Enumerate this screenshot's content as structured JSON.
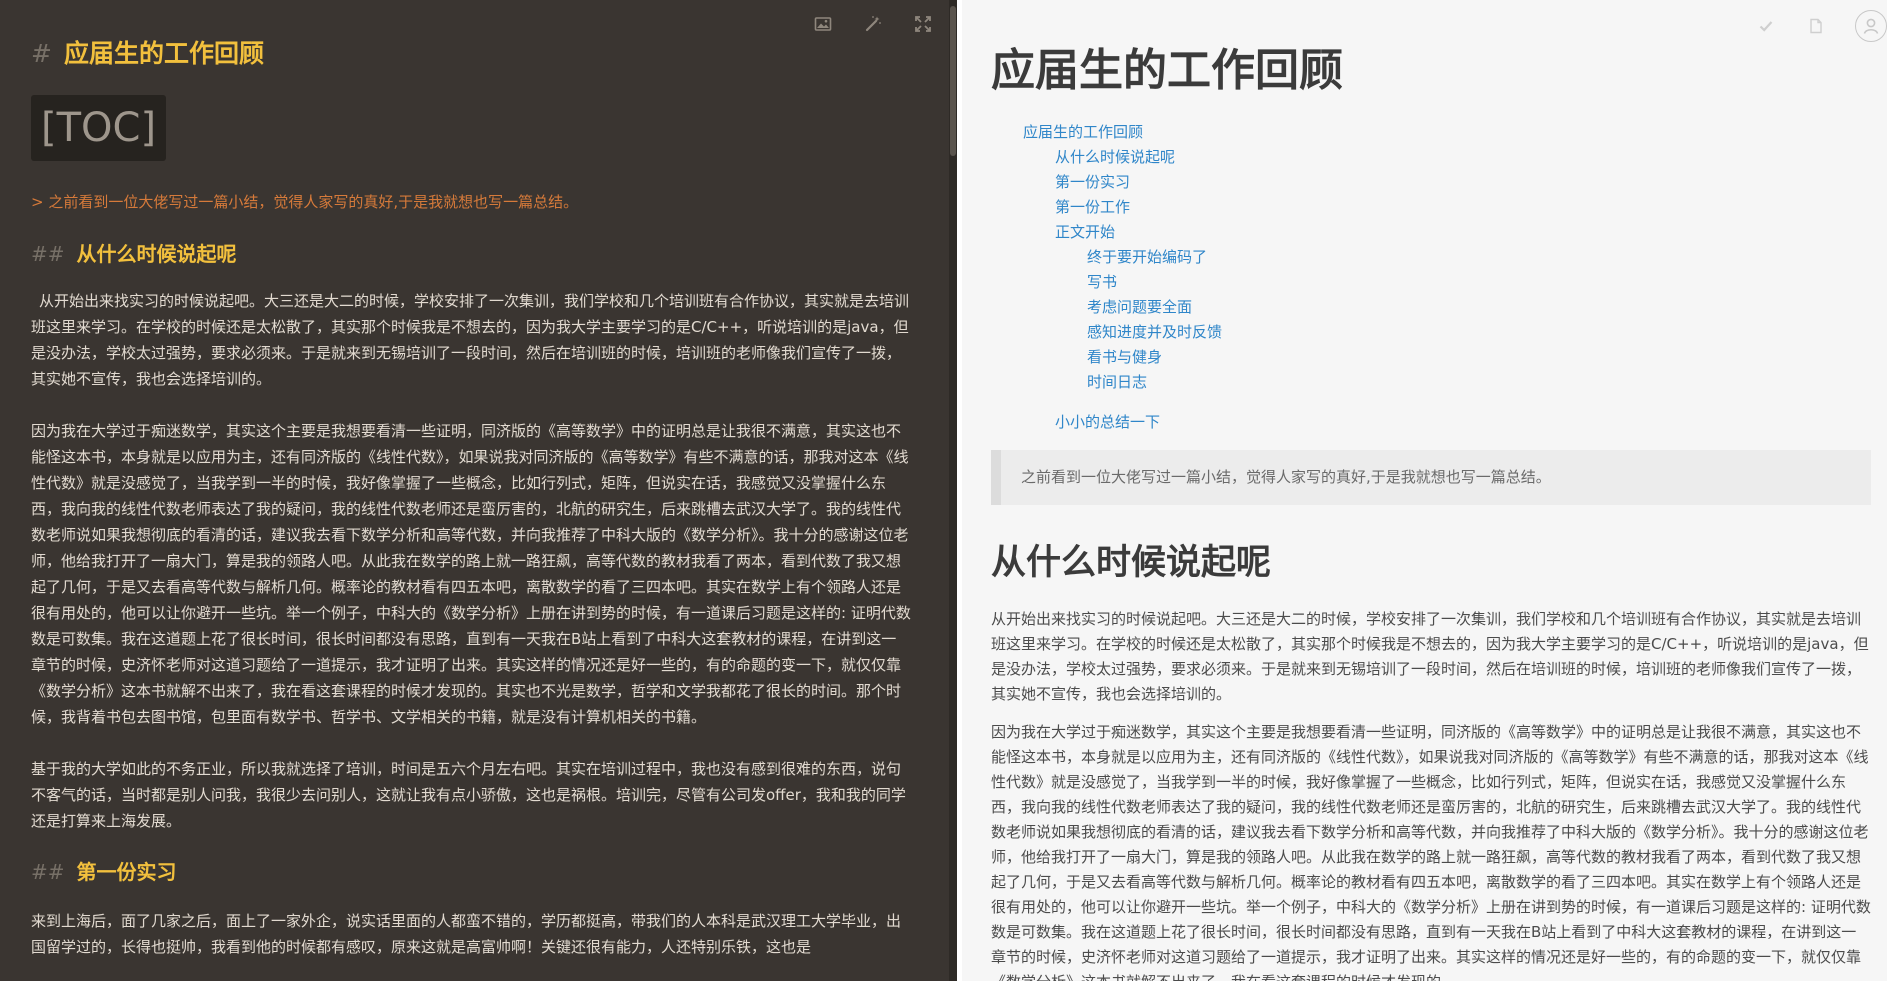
{
  "editor": {
    "toolbar": {
      "image_icon": "image-icon",
      "magic_icon": "magic-wand-icon",
      "expand_icon": "fullscreen-icon"
    },
    "h1_hash": "#",
    "h1": "应届生的工作回顾",
    "toc": "[TOC]",
    "quote": "> 之前看到一位大佬写过一篇小结，觉得人家写的真好,于是我就想也写一篇总结。",
    "h2_hash": "##",
    "h2_first": "从什么时候说起呢",
    "paragraphs": [
      "从开始出来找实习的时候说起吧。大三还是大二的时候，学校安排了一次集训，我们学校和几个培训班有合作协议，其实就是去培训班这里来学习。在学校的时候还是太松散了，其实那个时候我是不想去的，因为我大学主要学习的是C/C++，听说培训的是java，但是没办法，学校太过强势，要求必须来。于是就来到无锡培训了一段时间，然后在培训班的时候，培训班的老师像我们宣传了一拨，其实她不宣传，我也会选择培训的。",
      "因为我在大学过于痴迷数学，其实这个主要是我想要看清一些证明，同济版的《高等数学》中的证明总是让我很不满意，其实这也不能怪这本书，本身就是以应用为主，还有同济版的《线性代数》，如果说我对同济版的《高等数学》有些不满意的话，那我对这本《线性代数》就是没感觉了，当我学到一半的时候，我好像掌握了一些概念，比如行列式，矩阵，但说实在话，我感觉又没掌握什么东西，我向我的线性代数老师表达了我的疑问，我的线性代数老师还是蛮厉害的，北航的研究生，后来跳槽去武汉大学了。我的线性代数老师说如果我想彻底的看清的话，建议我去看下数学分析和高等代数，并向我推荐了中科大版的《数学分析》。我十分的感谢这位老师，他给我打开了一扇大门，算是我的领路人吧。从此我在数学的路上就一路狂飙，高等代数的教材我看了两本，看到代数了我又想起了几何，于是又去看高等代数与解析几何。概率论的教材看有四五本吧，离散数学的看了三四本吧。其实在数学上有个领路人还是很有用处的，他可以让你避开一些坑。举一个例子，中科大的《数学分析》上册在讲到势的时候，有一道课后习题是这样的: 证明代数数是可数集。我在这道题上花了很长时间，很长时间都没有思路，直到有一天我在B站上看到了中科大这套教材的课程，在讲到这一章节的时候，史济怀老师对这道习题给了一道提示，我才证明了出来。其实这样的情况还是好一些的，有的命题的变一下，就仅仅靠《数学分析》这本书就解不出来了，我在看这套课程的时候才发现的。其实也不光是数学，哲学和文学我都花了很长的时间。那个时候，我背着书包去图书馆，包里面有数学书、哲学书、文学相关的书籍，就是没有计算机相关的书籍。",
      "基于我的大学如此的不务正业，所以我就选择了培训，时间是五六个月左右吧。其实在培训过程中，我也没有感到很难的东西，说句不客气的话，当时都是别人问我，我很少去问别人，这就让我有点小骄傲，这也是祸根。培训完，尽管有公司发offer，我和我的同学还是打算来上海发展。"
    ],
    "h2_second": "第一份实习",
    "last_paragraph": "来到上海后，面了几家之后，面上了一家外企，说实话里面的人都蛮不错的，学历都挺高，带我们的人本科是武汉理工大学毕业，出国留学过的，长得也挺帅，我看到他的时候都有感叹，原来这就是高富帅啊！关键还很有能力，人还特别乐铁，这也是"
  },
  "preview": {
    "toolbar": {
      "check_icon": "check-icon",
      "doc_icon": "document-icon",
      "avatar_icon": "user-avatar-icon"
    },
    "h1": "应届生的工作回顾",
    "toc": [
      {
        "level": 1,
        "label": "应届生的工作回顾"
      },
      {
        "level": 2,
        "label": "从什么时候说起呢"
      },
      {
        "level": 2,
        "label": "第一份实习"
      },
      {
        "level": 2,
        "label": "第一份工作"
      },
      {
        "level": 2,
        "label": "正文开始"
      },
      {
        "level": 3,
        "label": "终于要开始编码了"
      },
      {
        "level": 3,
        "label": "写书"
      },
      {
        "level": 3,
        "label": "考虑问题要全面"
      },
      {
        "level": 3,
        "label": "感知进度并及时反馈"
      },
      {
        "level": 3,
        "label": "看书与健身"
      },
      {
        "level": 3,
        "label": "时间日志"
      },
      {
        "level": 2,
        "label": "小小的总结一下"
      }
    ],
    "quote": "之前看到一位大佬写过一篇小结，觉得人家写的真好,于是我就想也写一篇总结。",
    "h2": "从什么时候说起呢",
    "paragraphs": [
      "从开始出来找实习的时候说起吧。大三还是大二的时候，学校安排了一次集训，我们学校和几个培训班有合作协议，其实就是去培训班这里来学习。在学校的时候还是太松散了，其实那个时候我是不想去的，因为我大学主要学习的是C/C++，听说培训的是java，但是没办法，学校太过强势，要求必须来。于是就来到无锡培训了一段时间，然后在培训班的时候，培训班的老师像我们宣传了一拨，其实她不宣传，我也会选择培训的。",
      "因为我在大学过于痴迷数学，其实这个主要是我想要看清一些证明，同济版的《高等数学》中的证明总是让我很不满意，其实这也不能怪这本书，本身就是以应用为主，还有同济版的《线性代数》，如果说我对同济版的《高等数学》有些不满意的话，那我对这本《线性代数》就是没感觉了，当我学到一半的时候，我好像掌握了一些概念，比如行列式，矩阵，但说实在话，我感觉又没掌握什么东西，我向我的线性代数老师表达了我的疑问，我的线性代数老师还是蛮厉害的，北航的研究生，后来跳槽去武汉大学了。我的线性代数老师说如果我想彻底的看清的话，建议我去看下数学分析和高等代数，并向我推荐了中科大版的《数学分析》。我十分的感谢这位老师，他给我打开了一扇大门，算是我的领路人吧。从此我在数学的路上就一路狂飙，高等代数的教材我看了两本，看到代数了我又想起了几何，于是又去看高等代数与解析几何。概率论的教材看有四五本吧，离散数学的看了三四本吧。其实在数学上有个领路人还是很有用处的，他可以让你避开一些坑。举一个例子，中科大的《数学分析》上册在讲到势的时候，有一道课后习题是这样的: 证明代数数是可数集。我在这道题上花了很长时间，很长时间都没有思路，直到有一天我在B站上看到了中科大这套教材的课程，在讲到这一章节的时候，史济怀老师对这道习题给了一道提示，我才证明了出来。其实这样的情况还是好一些的，有的命题的变一下，就仅仅靠《数学分析》这本书就解不出来了，我在看这套课程的时候才发现的。"
    ]
  }
}
